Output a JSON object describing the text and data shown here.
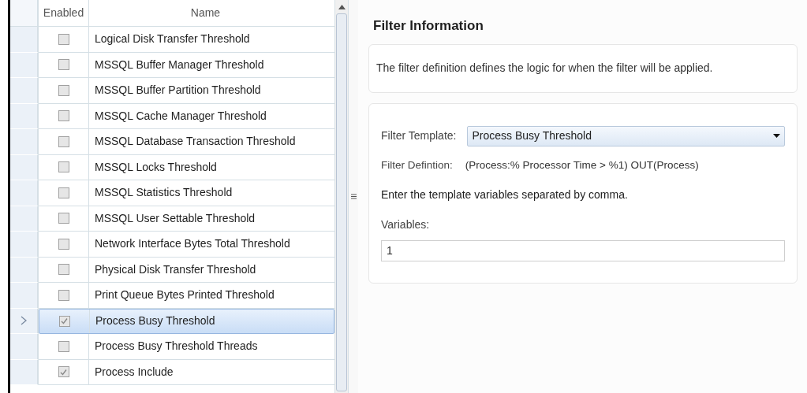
{
  "grid": {
    "columns": [
      "Enabled",
      "Name"
    ],
    "rows": [
      {
        "name": "Logical Disk Transfer Threshold",
        "enabled": false,
        "selected": false
      },
      {
        "name": "MSSQL Buffer Manager Threshold",
        "enabled": false,
        "selected": false
      },
      {
        "name": "MSSQL Buffer Partition Threshold",
        "enabled": false,
        "selected": false
      },
      {
        "name": "MSSQL Cache Manager Threshold",
        "enabled": false,
        "selected": false
      },
      {
        "name": "MSSQL Database Transaction Threshold",
        "enabled": false,
        "selected": false
      },
      {
        "name": "MSSQL Locks Threshold",
        "enabled": false,
        "selected": false
      },
      {
        "name": "MSSQL Statistics Threshold",
        "enabled": false,
        "selected": false
      },
      {
        "name": "MSSQL User Settable Threshold",
        "enabled": false,
        "selected": false
      },
      {
        "name": "Network Interface Bytes Total Threshold",
        "enabled": false,
        "selected": false
      },
      {
        "name": "Physical Disk Transfer Threshold",
        "enabled": false,
        "selected": false
      },
      {
        "name": "Print Queue Bytes Printed Threshold",
        "enabled": false,
        "selected": false
      },
      {
        "name": "Process Busy Threshold",
        "enabled": true,
        "selected": true
      },
      {
        "name": "Process Busy Threshold Threads",
        "enabled": false,
        "selected": false
      },
      {
        "name": "Process Include",
        "enabled": true,
        "selected": false
      }
    ]
  },
  "panel": {
    "title": "Filter Information",
    "description": "The filter definition defines the logic for when the filter will be applied.",
    "template_label": "Filter Template:",
    "template_value": "Process Busy Threshold",
    "definition_label": "Filter Defintion:",
    "definition_value": "(Process:% Processor Time > %1) OUT(Process)",
    "hint": "Enter the template variables separated by comma.",
    "variables_label": "Variables:",
    "variables_value": "1"
  }
}
